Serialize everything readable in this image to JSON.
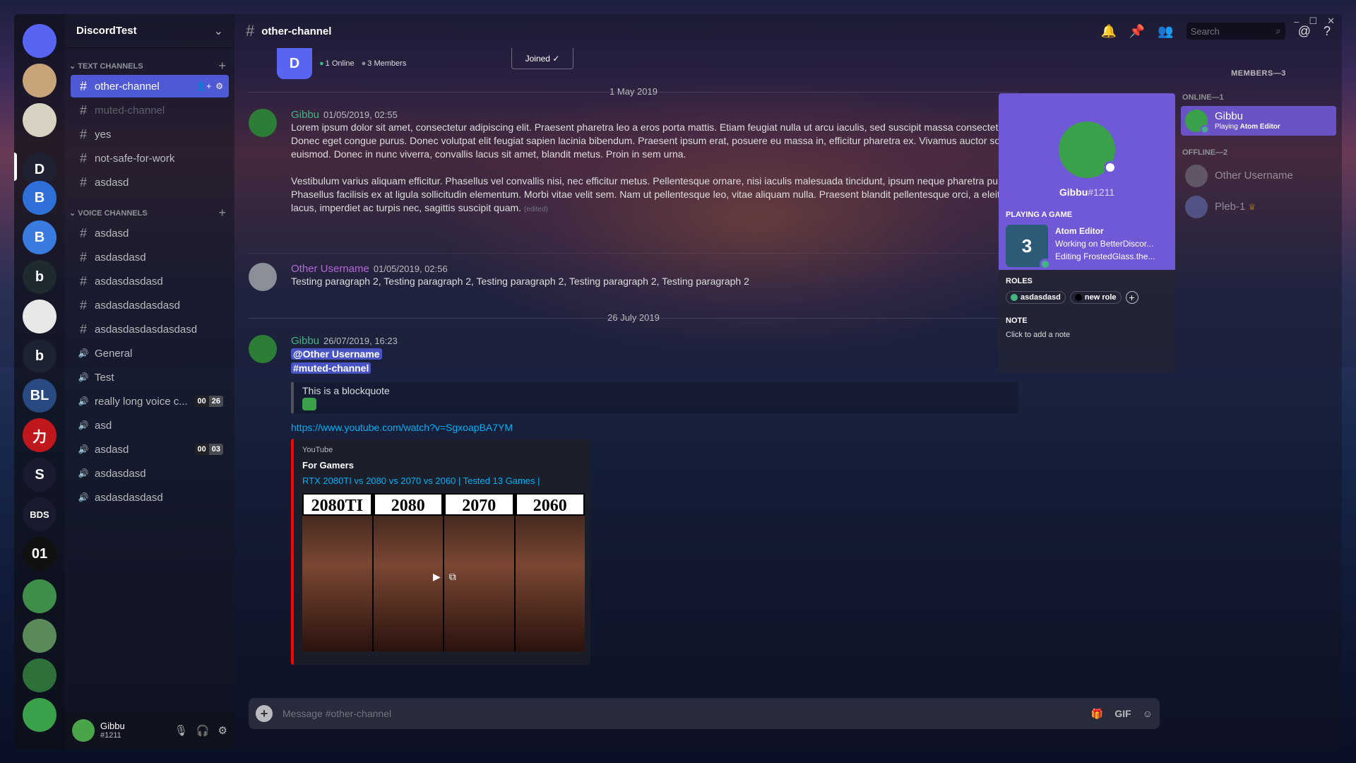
{
  "window": {
    "controls": [
      "–",
      "☐",
      "✕"
    ]
  },
  "server": {
    "name": "DiscordTest"
  },
  "guilds": [
    {
      "label": "",
      "color": "#5865f2",
      "name": "discord-home"
    },
    {
      "label": "",
      "color": "#c9a37a",
      "name": "guild-1"
    },
    {
      "label": "",
      "color": "#d8d2c2",
      "name": "guild-2"
    },
    {
      "label": "D",
      "color": "#1e2130",
      "name": "guild-discordtest"
    },
    {
      "label": "B",
      "color": "#2f6fd8",
      "name": "guild-4"
    },
    {
      "label": "B",
      "color": "#3a7be0",
      "name": "guild-5"
    },
    {
      "label": "b",
      "color": "#1f2a30",
      "name": "guild-6"
    },
    {
      "label": "",
      "color": "#e8e8e8",
      "name": "guild-7"
    },
    {
      "label": "b",
      "color": "#1c2230",
      "name": "guild-8"
    },
    {
      "label": "BL",
      "color": "#284a80",
      "name": "guild-9"
    },
    {
      "label": "力",
      "color": "#c0171c",
      "name": "guild-10"
    },
    {
      "label": "S",
      "color": "#1a1a2e",
      "name": "guild-11"
    },
    {
      "label": "BDS",
      "color": "#1a1a2e",
      "name": "guild-12"
    },
    {
      "label": "01",
      "color": "#111111",
      "name": "guild-13"
    },
    {
      "label": "",
      "color": "#3f8f4a",
      "name": "guild-14"
    },
    {
      "label": "",
      "color": "#5a8a5a",
      "name": "guild-15"
    },
    {
      "label": "",
      "color": "#2f6f3a",
      "name": "guild-16"
    },
    {
      "label": "",
      "color": "#3aa04a",
      "name": "guild-17"
    }
  ],
  "sidebar": {
    "text_category": "Text Channels",
    "voice_category": "Voice Channels",
    "text_channels": [
      {
        "label": "other-channel",
        "selected": true,
        "muted": false
      },
      {
        "label": "muted-channel",
        "selected": false,
        "muted": true
      },
      {
        "label": "yes",
        "selected": false,
        "muted": false
      },
      {
        "label": "not-safe-for-work",
        "selected": false,
        "muted": false
      },
      {
        "label": "asdasd",
        "selected": false,
        "muted": false
      }
    ],
    "voice_channels": [
      {
        "label": "asdasd",
        "icon": "#"
      },
      {
        "label": "asdasdasd",
        "icon": "#"
      },
      {
        "label": "asdasdasdasd",
        "icon": "#"
      },
      {
        "label": "asdasdasdasdasd",
        "icon": "#"
      },
      {
        "label": "asdasdasdasdasdasd",
        "icon": "#"
      },
      {
        "label": "General",
        "icon": "🔊"
      },
      {
        "label": "Test",
        "icon": "🔊"
      },
      {
        "label": "really long voice c...",
        "icon": "🔊",
        "count": [
          "00",
          "26"
        ]
      },
      {
        "label": "asd",
        "icon": "🔊"
      },
      {
        "label": "asdasd",
        "icon": "🔊",
        "count": [
          "00",
          "03"
        ]
      },
      {
        "label": "asdasdasd",
        "icon": "🔊"
      },
      {
        "label": "asdasdasdasd",
        "icon": "🔊"
      }
    ]
  },
  "user_panel": {
    "name": "Gibbu",
    "tag": "#1211"
  },
  "topbar": {
    "channel": "other-channel",
    "search_placeholder": "Search"
  },
  "welcome": {
    "online": "1 Online",
    "members": "3 Members",
    "joined": "Joined"
  },
  "dates": {
    "d1": "1 May 2019",
    "d2": "26 July 2019"
  },
  "messages": [
    {
      "author": "Gibbu",
      "color": "#43b581",
      "time": "01/05/2019, 02:55",
      "lines": [
        "Lorem ipsum dolor sit amet, consectetur adipiscing elit. Praesent pharetra leo a eros porta mattis. Etiam feugiat nulla ut arcu iaculis, sed suscipit massa consectet",
        "Donec eget congue purus. Donec volutpat elit feugiat sapien lacinia bibendum. Praesent ipsum erat, posuere eu massa in, efficitur pharetra ex. Vivamus auctor so",
        "euismod. Donec in nunc viverra, convallis lacus sit amet, blandit metus. Proin in sem urna."
      ],
      "lines2": [
        "Vestibulum varius aliquam efficitur. Phasellus vel convallis nisi, nec efficitur metus. Pellentesque ornare, nisi iaculis malesuada tincidunt, ipsum neque pharetra pu",
        "Phasellus facilisis ex at ligula sollicitudin elementum. Morbi vitae velit sem. Nam ut pellentesque leo, vitae aliquam nulla. Praesent blandit pellentesque orci, a eleit",
        "lacus, imperdiet ac turpis nec, sagittis suscipit quam."
      ],
      "edited": "(edited)"
    },
    {
      "author": "Other Username",
      "color": "#b767d8",
      "time": "01/05/2019, 02:56",
      "text": "Testing paragraph 2, Testing paragraph 2, Testing paragraph 2, Testing paragraph 2, Testing paragraph 2"
    },
    {
      "author": "Gibbu",
      "color": "#43b581",
      "time": "26/07/2019, 16:23",
      "mention1": "@Other Username",
      "mention2": "#muted-channel",
      "blockquote": "This is a blockquote",
      "link": "https://www.youtube.com/watch?v=SgxoapBA7YM",
      "embed": {
        "provider": "YouTube",
        "author": "For Gamers",
        "title": "RTX 2080TI vs 2080 vs 2070 vs 2060 | Tested 13 Games |",
        "thumb_labels": [
          "2080TI",
          "2080",
          "2070",
          "2060"
        ]
      }
    }
  ],
  "input": {
    "placeholder": "Message #other-channel"
  },
  "popout": {
    "name": "Gibbu",
    "tag": "#1211",
    "playing_header": "Playing a game",
    "game": "Atom Editor",
    "detail1": "Working on BetterDiscor...",
    "detail2": "Editing FrostedGlass.the...",
    "roles_header": "Roles",
    "roles": [
      {
        "label": "asdasdasd",
        "color": "#43b581"
      },
      {
        "label": "new role",
        "color": "#000000"
      }
    ],
    "note_header": "Note",
    "note": "Click to add a note"
  },
  "members": {
    "title": "MEMBERS—3",
    "online_header": "ONLINE—1",
    "offline_header": "OFFLINE—2",
    "online": [
      {
        "name": "Gibbu",
        "activity_prefix": "Playing",
        "activity": "Atom Editor"
      }
    ],
    "offline": [
      {
        "name": "Other Username"
      },
      {
        "name": "Pleb-1"
      }
    ]
  }
}
